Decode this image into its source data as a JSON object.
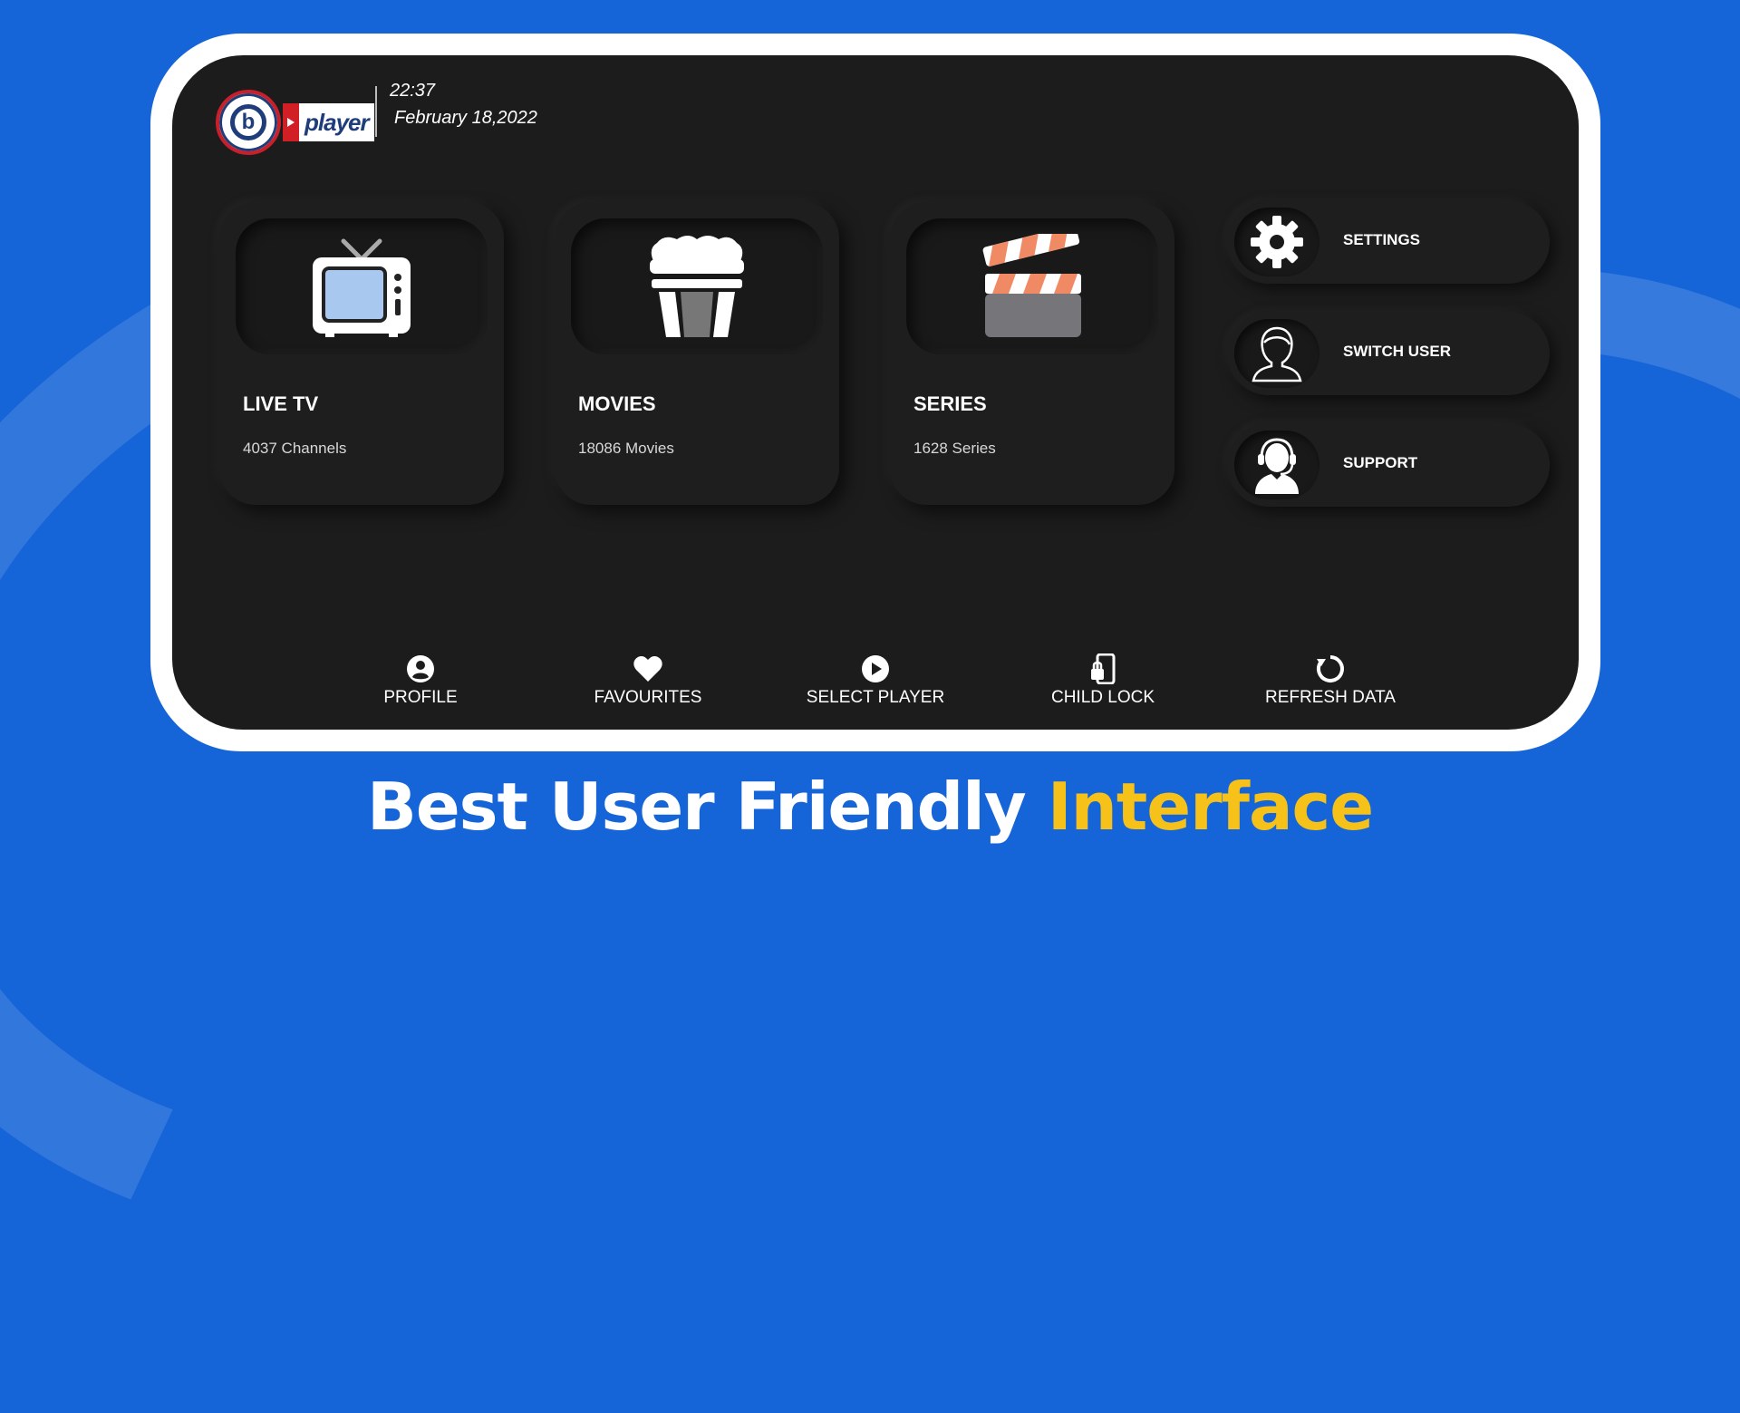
{
  "app": {
    "logo_text": "player",
    "logo_letter": "b",
    "time": "22:37",
    "date": "February 18,2022"
  },
  "cards": [
    {
      "title": "LIVE TV",
      "subtitle": "4037 Channels",
      "icon": "tv-icon"
    },
    {
      "title": "MOVIES",
      "subtitle": "18086 Movies",
      "icon": "popcorn-icon"
    },
    {
      "title": "SERIES",
      "subtitle": "1628 Series",
      "icon": "clapperboard-icon"
    }
  ],
  "side_menu": [
    {
      "label": "SETTINGS",
      "icon": "gear-icon"
    },
    {
      "label": "SWITCH USER",
      "icon": "user-icon"
    },
    {
      "label": "SUPPORT",
      "icon": "headset-icon"
    }
  ],
  "bottom_bar": [
    {
      "label": "PROFILE",
      "icon": "profile-icon"
    },
    {
      "label": "FAVOURITES",
      "icon": "heart-icon"
    },
    {
      "label": "SELECT PLAYER",
      "icon": "play-circle-icon"
    },
    {
      "label": "CHILD LOCK",
      "icon": "phone-lock-icon"
    },
    {
      "label": "REFRESH DATA",
      "icon": "refresh-icon"
    }
  ],
  "headline": {
    "main": "Best User Friendly ",
    "accent": "Interface"
  },
  "colors": {
    "background": "#1665d8",
    "screen": "#1c1c1c",
    "accent": "#f6c21a",
    "clapper_stripe": "#f08a64",
    "tv_screen": "#a9c8f0"
  }
}
